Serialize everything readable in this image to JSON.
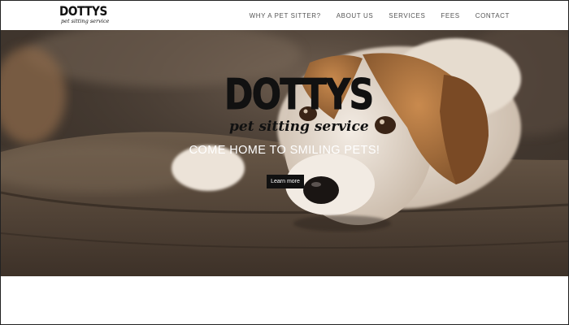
{
  "header": {
    "logo_main": "DOTTYS",
    "logo_sub": "pet sitting service",
    "nav": [
      {
        "label": "WHY A PET SITTER?"
      },
      {
        "label": "ABOUT US"
      },
      {
        "label": "SERVICES"
      },
      {
        "label": "FEES"
      },
      {
        "label": "CONTACT"
      }
    ]
  },
  "hero": {
    "logo_main": "DOTTYS",
    "logo_sub": "pet sitting service",
    "tagline": "COME HOME TO SMILING PETS!",
    "button_label": "Learn more"
  }
}
